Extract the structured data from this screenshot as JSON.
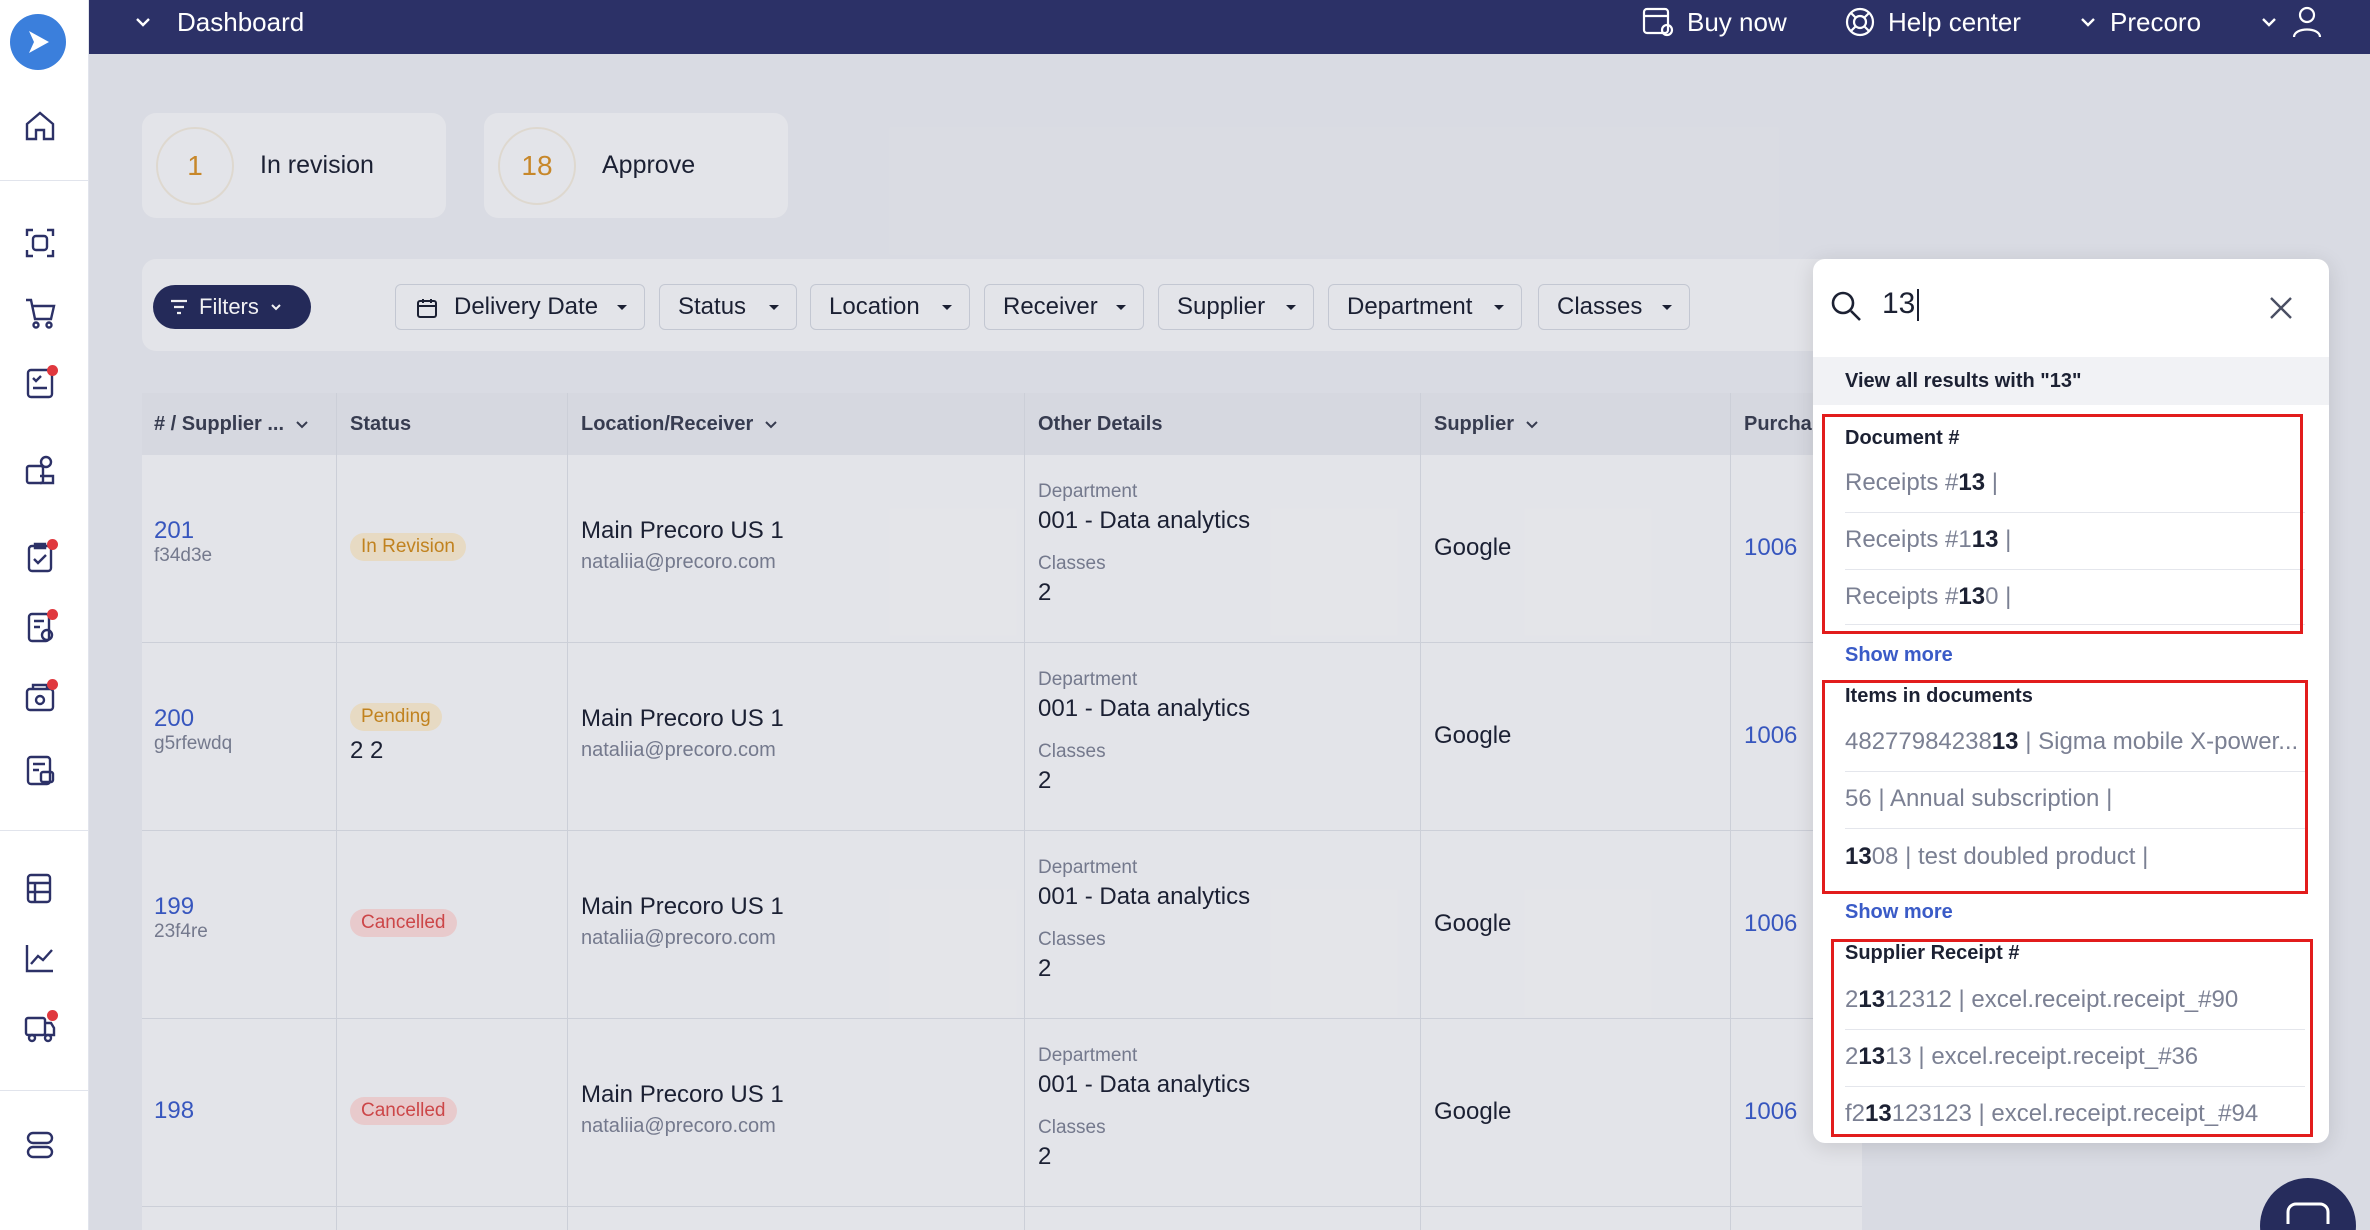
{
  "topbar": {
    "title": "Dashboard",
    "buy_now": "Buy now",
    "help_center": "Help center",
    "company": "Precoro"
  },
  "cards": [
    {
      "count": "1",
      "label": "In revision"
    },
    {
      "count": "18",
      "label": "Approve"
    }
  ],
  "filters": {
    "filters_label": "Filters",
    "chips": [
      "Delivery Date",
      "Status",
      "Location",
      "Receiver",
      "Supplier",
      "Department",
      "Classes"
    ]
  },
  "table": {
    "headers": {
      "number": "# / Supplier ...",
      "status": "Status",
      "location": "Location/Receiver",
      "details": "Other Details",
      "supplier": "Supplier",
      "purchase": "Purcha"
    },
    "rows": [
      {
        "number": "201",
        "code": "f34d3e",
        "status": "In Revision",
        "status_extra": "",
        "location": "Main Precoro US 1",
        "email": "nataliia@precoro.com",
        "dept_label": "Department",
        "dept": "001 - Data analytics",
        "classes_label": "Classes",
        "classes": "2",
        "supplier": "Google",
        "po": "1006"
      },
      {
        "number": "200",
        "code": "g5rfewdq",
        "status": "Pending",
        "status_extra": "2 2",
        "location": "Main Precoro US 1",
        "email": "nataliia@precoro.com",
        "dept_label": "Department",
        "dept": "001 - Data analytics",
        "classes_label": "Classes",
        "classes": "2",
        "supplier": "Google",
        "po": "1006"
      },
      {
        "number": "199",
        "code": "23f4re",
        "status": "Cancelled",
        "status_extra": "",
        "location": "Main Precoro US 1",
        "email": "nataliia@precoro.com",
        "dept_label": "Department",
        "dept": "001 - Data analytics",
        "classes_label": "Classes",
        "classes": "2",
        "supplier": "Google",
        "po": "1006"
      },
      {
        "number": "198",
        "code": "",
        "status": "Cancelled",
        "status_extra": "",
        "location": "Main Precoro US 1",
        "email": "nataliia@precoro.com",
        "dept_label": "Department",
        "dept": "001 - Data analytics",
        "classes_label": "Classes",
        "classes": "2",
        "supplier": "Google",
        "po": "1006"
      }
    ]
  },
  "search": {
    "query": "13",
    "view_all": "View all results with \"13\"",
    "show_more": "Show more",
    "document_section": {
      "title": "Document #",
      "items": [
        {
          "pre": "Receipts #",
          "hit": "13",
          "post": " |"
        },
        {
          "pre": "Receipts #1",
          "hit": "13",
          "post": " |"
        },
        {
          "pre": "Receipts #",
          "hit": "13",
          "post": "0 |"
        }
      ]
    },
    "items_section": {
      "title": "Items in documents",
      "items": [
        {
          "pre": "4827798423813"
        },
        {
          "pre": "",
          "hit": "",
          "post": "56 | Annual subscription |"
        },
        {
          "pre": "",
          "hit": "13",
          "post": "08 | test doubled product |"
        }
      ],
      "item1_code_pre": "48277984238",
      "item1_code_hit": "13",
      "item1_rest": " | Sigma mobile X-power..."
    },
    "receipt_section": {
      "title": "Supplier Receipt #",
      "items": [
        {
          "pre": "2",
          "hit": "13",
          "post": "12312 | excel.receipt.receipt_#90"
        },
        {
          "pre": "2",
          "hit": "13",
          "post": "13 | excel.receipt.receipt_#36"
        },
        {
          "pre": "f2",
          "hit": "13",
          "post": "123123 | excel.receipt.receipt_#94"
        }
      ]
    }
  },
  "colors": {
    "topbar": "#2c3167",
    "accent": "#3a5bc7",
    "highlight_box": "#e21c1c",
    "badge_warn": "#cc8a1e",
    "badge_danger": "#d84a4a"
  }
}
